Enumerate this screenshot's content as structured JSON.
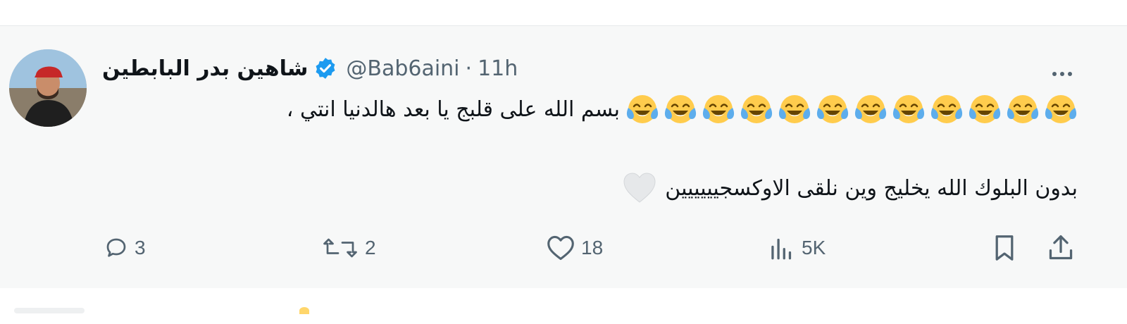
{
  "tweet": {
    "display_name": "شاهين بدر البابطين",
    "handle": "@Bab6aini",
    "separator": "·",
    "time": "11h",
    "line1_text": "بسم الله على قلبج يا بعد هالدنيا انتي ،",
    "line1_emoji_count": 12,
    "line1_emoji": "face-with-tears-of-joy",
    "line2_text": "بدون البلوك الله يخليج وين نلقى الاوكسجيييييين",
    "line2_emoji": "white-heart",
    "verified_color": "#1d9bf0"
  },
  "actions": {
    "replies": "3",
    "reposts": "2",
    "likes": "18",
    "views": "5K"
  },
  "colors": {
    "background": "#f7f8f8",
    "secondary_text": "#536471",
    "primary_text": "#0f1419"
  }
}
